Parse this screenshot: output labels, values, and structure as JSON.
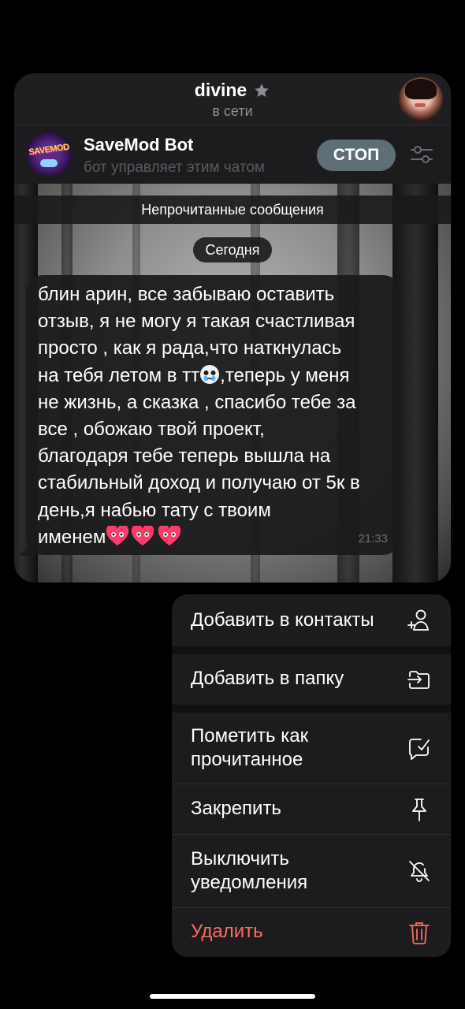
{
  "header": {
    "title": "divine",
    "status": "в сети"
  },
  "bot_bar": {
    "logo_text": "SAVEMOD",
    "name": "SaveMod Bot",
    "subtitle": "бот управляет этим чатом",
    "stop_label": "СТОП"
  },
  "chat": {
    "unread_label": "Непрочитанные сообщения",
    "date_label": "Сегодня",
    "message": {
      "lines": [
        "блин арин, все забываю оставить",
        "отзыв, я не могу я такая счастливая",
        "просто , как я рада,что наткнулась",
        "на тебя летом в тт",
        ",теперь у меня",
        "не жизнь, а сказка , спасибо тебе за",
        "все , обожаю твой проект,",
        "благодаря тебе теперь вышла на",
        "стабильный доход и получаю от 5к в",
        "день,я набью тату с твоим",
        "именем"
      ],
      "time": "21:33"
    }
  },
  "menu": {
    "items": [
      {
        "label": "Добавить в контакты",
        "icon": "add-contact-icon"
      },
      {
        "label": "Добавить в папку",
        "icon": "add-to-folder-icon"
      },
      {
        "label": "Пометить как",
        "label2": "прочитанное",
        "icon": "mark-read-icon"
      },
      {
        "label": "Закрепить",
        "icon": "pin-icon"
      },
      {
        "label": "Выключить",
        "label2": "уведомления",
        "icon": "mute-icon"
      },
      {
        "label": "Удалить",
        "icon": "trash-icon"
      }
    ]
  },
  "colors": {
    "stop_button": "#5e6e77",
    "danger": "#ff6b62",
    "menu_bg": "#1c1c1e"
  }
}
